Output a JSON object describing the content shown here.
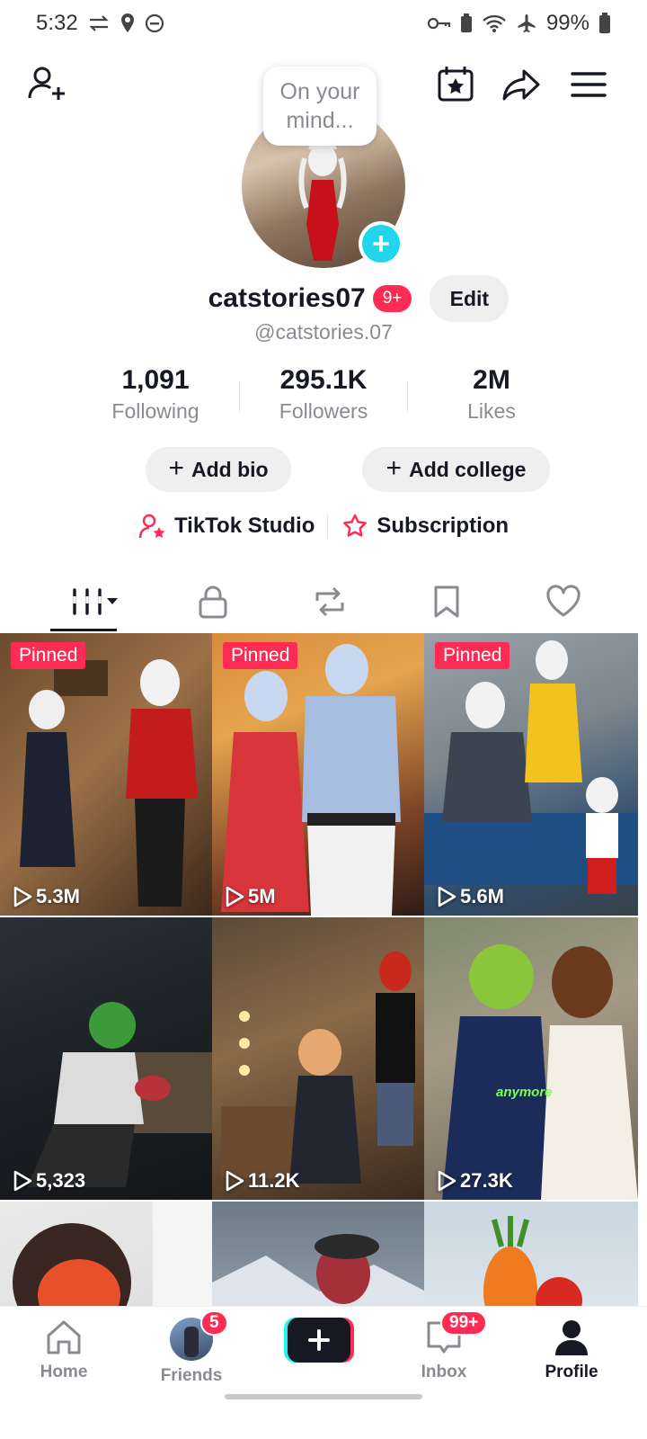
{
  "status_bar": {
    "time": "5:32",
    "battery": "99%"
  },
  "header": {
    "bubble_text": "On your mind...",
    "username": "catstories07",
    "notif_badge": "9+",
    "edit_label": "Edit",
    "handle": "@catstories.07"
  },
  "stats": [
    {
      "value": "1,091",
      "label": "Following"
    },
    {
      "value": "295.1K",
      "label": "Followers"
    },
    {
      "value": "2M",
      "label": "Likes"
    }
  ],
  "actions": {
    "add_bio": "Add bio",
    "add_college": "Add college",
    "studio": "TikTok Studio",
    "subscription": "Subscription"
  },
  "videos": [
    {
      "pinned": "Pinned",
      "views": "5.3M"
    },
    {
      "pinned": "Pinned",
      "views": "5M"
    },
    {
      "pinned": "Pinned",
      "views": "5.6M"
    },
    {
      "views": "5,323"
    },
    {
      "views": "11.2K"
    },
    {
      "views": "27.3K",
      "caption": "anymore"
    }
  ],
  "nav": {
    "home": "Home",
    "friends": "Friends",
    "friends_badge": "5",
    "inbox": "Inbox",
    "inbox_badge": "99+",
    "profile": "Profile"
  },
  "colors": {
    "accent_red": "#fe2c55",
    "accent_cyan": "#20d5ec",
    "text_primary": "#161823",
    "text_secondary": "#8a8b91"
  }
}
